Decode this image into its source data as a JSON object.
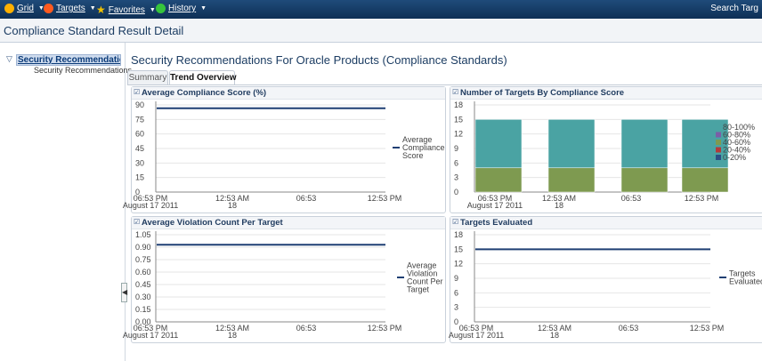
{
  "topbar": {
    "menus": [
      {
        "label": "Grid",
        "icon": "grid-icon",
        "color": "#ffb000"
      },
      {
        "label": "Targets",
        "icon": "targets-icon",
        "color": "#ff5a1f"
      },
      {
        "label": "Favorites",
        "icon": "star-icon",
        "color": "#f2c200"
      },
      {
        "label": "History",
        "icon": "history-icon",
        "color": "#36c43c"
      }
    ],
    "search_label": "Search Targ"
  },
  "page_header": {
    "title": "Compliance Standard Result Detail"
  },
  "sidebar": {
    "selected_label": "Security Recommendations Fo",
    "child_label": "Security Recommendations"
  },
  "main": {
    "title": "Security Recommendations For Oracle Products (Compliance Standards)",
    "tabs": [
      {
        "label": "Summary",
        "active": false
      },
      {
        "label": "Trend Overview",
        "active": true
      }
    ]
  },
  "panels": [
    {
      "title": "Average Compliance Score (%)"
    },
    {
      "title": "Number of Targets By Compliance Score"
    },
    {
      "title": "Average Violation Count Per Target"
    },
    {
      "title": "Targets Evaluated"
    }
  ],
  "chart_data": [
    {
      "type": "line",
      "title": "Average Compliance Score (%)",
      "y_ticks": [
        "90",
        "75",
        "60",
        "45",
        "30",
        "15",
        "0"
      ],
      "ylim": [
        0,
        90
      ],
      "x_ticks": [
        [
          "06:53 PM",
          "August 17 2011"
        ],
        [
          "12:53 AM",
          "18"
        ],
        [
          "06:53",
          ""
        ],
        [
          "12:53 PM",
          ""
        ]
      ],
      "series": [
        {
          "name": "Average Compliance Score",
          "color": "#1f3f73",
          "values": [
            86.5,
            86.5
          ]
        }
      ]
    },
    {
      "type": "bar",
      "title": "Number of Targets By Compliance Score",
      "y_ticks": [
        "18",
        "15",
        "12",
        "9",
        "6",
        "3",
        "0"
      ],
      "ylim": [
        0,
        18
      ],
      "x_ticks": [
        [
          "06:53 PM",
          "August 17 2011"
        ],
        [
          "12:53 AM",
          "18"
        ],
        [
          "06:53",
          ""
        ],
        [
          "12:53 PM",
          ""
        ]
      ],
      "categories": [
        "06:53 PM",
        "12:53 AM",
        "06:53",
        "12:53 PM"
      ],
      "series": [
        {
          "name": "80-100%",
          "color": "#4aa3a3",
          "values": [
            10,
            10,
            10,
            10
          ]
        },
        {
          "name": "60-80%",
          "color": "#7b5ea7",
          "values": [
            0,
            0,
            0,
            0
          ]
        },
        {
          "name": "40-60%",
          "color": "#7e9a50",
          "values": [
            5,
            5,
            5,
            5
          ]
        },
        {
          "name": "20-40%",
          "color": "#b33a3a",
          "values": [
            0,
            0,
            0,
            0
          ]
        },
        {
          "name": "0-20%",
          "color": "#2c4f85",
          "values": [
            0,
            0,
            0,
            0
          ]
        }
      ]
    },
    {
      "type": "line",
      "title": "Average Violation Count Per Target",
      "y_ticks": [
        "1.05",
        "0.90",
        "0.75",
        "0.60",
        "0.45",
        "0.30",
        "0.15",
        "0.00"
      ],
      "ylim": [
        0,
        1.05
      ],
      "x_ticks": [
        [
          "06:53 PM",
          "August 17 2011"
        ],
        [
          "12:53 AM",
          "18"
        ],
        [
          "06:53",
          ""
        ],
        [
          "12:53 PM",
          ""
        ]
      ],
      "series": [
        {
          "name": "Average Violation Count Per Target",
          "color": "#1f3f73",
          "values": [
            0.93,
            0.93
          ]
        }
      ]
    },
    {
      "type": "line",
      "title": "Targets Evaluated",
      "y_ticks": [
        "18",
        "15",
        "12",
        "9",
        "6",
        "3",
        "0"
      ],
      "ylim": [
        0,
        18
      ],
      "x_ticks": [
        [
          "06:53 PM",
          "August 17 2011"
        ],
        [
          "12:53 AM",
          "18"
        ],
        [
          "06:53",
          ""
        ],
        [
          "12:53 PM",
          ""
        ]
      ],
      "series": [
        {
          "name": "Targets Evaluated",
          "color": "#1f3f73",
          "values": [
            15,
            15
          ]
        }
      ]
    }
  ]
}
